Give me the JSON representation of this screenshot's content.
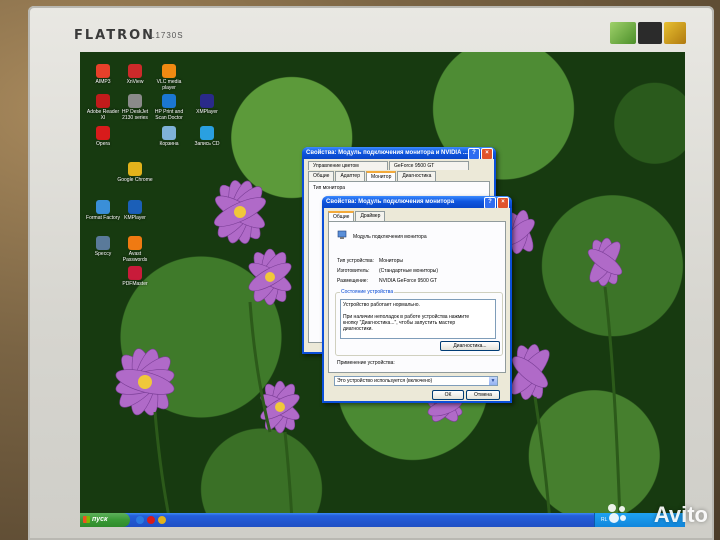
{
  "monitor": {
    "brand": "FLATRON",
    "model": "L1730S"
  },
  "desktop_icons": [
    {
      "label": "AIMP3",
      "color": "#e8402a"
    },
    {
      "label": "XnView",
      "color": "#cc2a2a"
    },
    {
      "label": "VLC media player",
      "color": "#f08a12"
    },
    {
      "label": "Adobe Reader XI",
      "color": "#c11b1b"
    },
    {
      "label": "HP DeskJet 2130 series",
      "color": "#8a8a8a"
    },
    {
      "label": "HP Print and Scan Doctor",
      "color": "#1b77d2"
    },
    {
      "label": "XMPlayer",
      "color": "#2a2a8a"
    },
    {
      "label": "Opera",
      "color": "#d81b1b"
    },
    {
      "label": "Корзина",
      "color": "#7fb2d8"
    },
    {
      "label": "Запись CD",
      "color": "#2aa0e0"
    },
    {
      "label": "Google Chrome",
      "color": "#e2b21b"
    },
    {
      "label": "Format Factory",
      "color": "#3a8fd8"
    },
    {
      "label": "KMPlayer",
      "color": "#1b5fb8"
    },
    {
      "label": "Speccy",
      "color": "#5a7a9a"
    },
    {
      "label": "Avast Passwords",
      "color": "#f07a12"
    },
    {
      "label": "PDFMaster",
      "color": "#c81b3a"
    }
  ],
  "back_window": {
    "title": "Свойства: Модуль подключения монитора и NVIDIA ...",
    "tabs": [
      "Управление цветом",
      "GeForce 9500 GT",
      "Общие",
      "Адаптер",
      "Монитор",
      "Диагностика"
    ],
    "active_tab": "Монитор",
    "partial_label": "Тип монитора"
  },
  "front_window": {
    "title": "Свойства: Модуль подключения монитора",
    "tabs": [
      "Общие",
      "Драйвер"
    ],
    "active_tab": "Общие",
    "device_name": "Модуль подключения монитора",
    "fields": [
      {
        "label": "Тип устройства:",
        "value": "Мониторы"
      },
      {
        "label": "Изготовитель:",
        "value": "(Стандартные мониторы)"
      },
      {
        "label": "Размещение:",
        "value": "NVIDIA GeForce 9500 GT"
      }
    ],
    "status_group": "Состояние устройства",
    "status_line1": "Устройство работает нормально.",
    "status_line2": "При наличии неполадок в работе устройства нажмите",
    "status_line3": "кнопку \"Диагностика...\", чтобы запустить мастер",
    "status_line4": "диагностики.",
    "diagnose_button": "Диагностика...",
    "usage_label": "Применение устройства:",
    "usage_value": "Это устройство используется (включено)",
    "ok_button": "ОК",
    "cancel_button": "Отмена"
  },
  "taskbar": {
    "start_label": "пуск",
    "tray_lang": "RL"
  },
  "watermark": "Avito"
}
